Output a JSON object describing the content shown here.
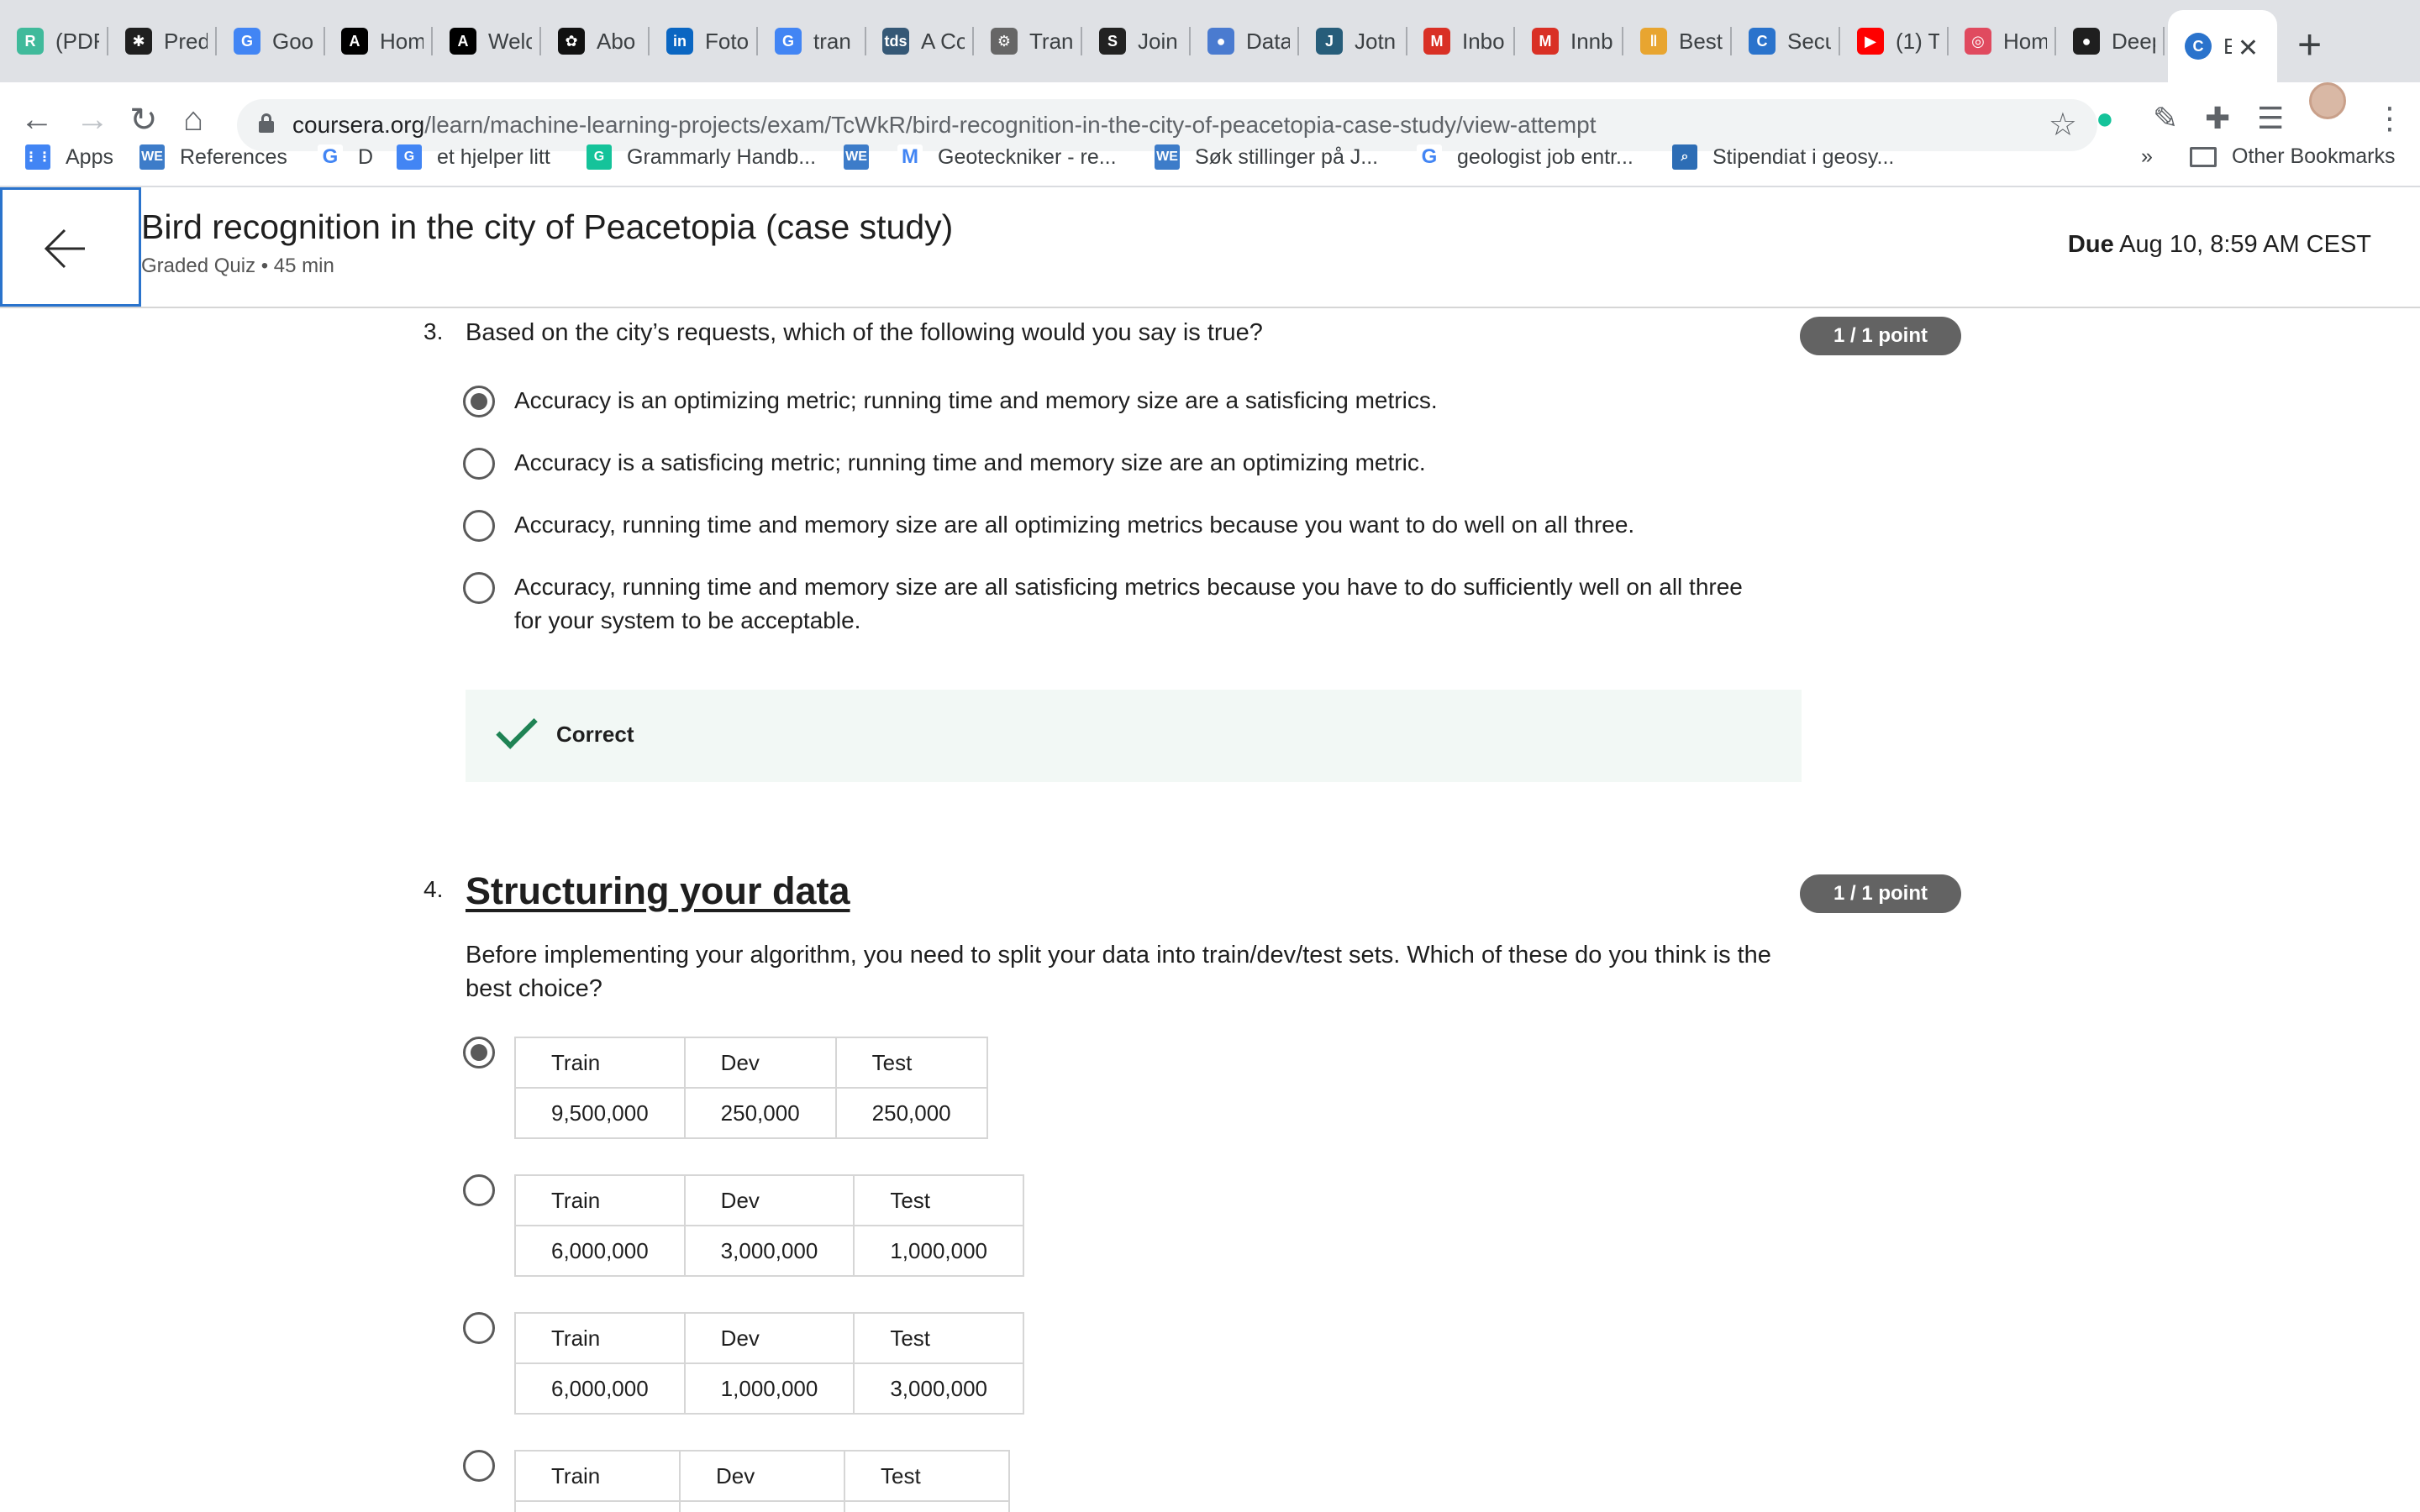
{
  "browser": {
    "tabs": [
      {
        "title": "(PDF",
        "icon": "researchgate-icon",
        "color": "#40ba9b",
        "glyph": "R"
      },
      {
        "title": "Pred",
        "icon": "gear-logo-icon",
        "color": "#1f1f1f",
        "glyph": "✱"
      },
      {
        "title": "Goo",
        "icon": "google-translate-icon",
        "color": "#4285f4",
        "glyph": "G"
      },
      {
        "title": "Hom",
        "icon": "letter-a-icon",
        "color": "#000000",
        "glyph": "A"
      },
      {
        "title": "Welc",
        "icon": "letter-a-icon",
        "color": "#000000",
        "glyph": "A"
      },
      {
        "title": "Abo",
        "icon": "openai-icon",
        "color": "#111111",
        "glyph": "✿"
      },
      {
        "title": "Foto",
        "icon": "linkedin-icon",
        "color": "#0a66c2",
        "glyph": "in"
      },
      {
        "title": "tran",
        "icon": "google-icon",
        "color": "#4285f4",
        "glyph": "G"
      },
      {
        "title": "A Co",
        "icon": "tds-icon",
        "color": "#355876",
        "glyph": "tds"
      },
      {
        "title": "Tran",
        "icon": "bike-icon",
        "color": "#666666",
        "glyph": "⚙"
      },
      {
        "title": "Join",
        "icon": "slack-s-icon",
        "color": "#222222",
        "glyph": "S"
      },
      {
        "title": "Data",
        "icon": "drop-icon",
        "color": "#4a7bd0",
        "glyph": "●"
      },
      {
        "title": "Jotn",
        "icon": "letter-j-icon",
        "color": "#275d7a",
        "glyph": "J"
      },
      {
        "title": "Inbo",
        "icon": "gmail-icon",
        "color": "#d93025",
        "glyph": "M"
      },
      {
        "title": "Innb",
        "icon": "gmail-icon",
        "color": "#d93025",
        "glyph": "M"
      },
      {
        "title": "Best",
        "icon": "bars-icon",
        "color": "#e8a530",
        "glyph": "‖"
      },
      {
        "title": "Secu",
        "icon": "coursera-icon",
        "color": "#2a73cc",
        "glyph": "C"
      },
      {
        "title": "(1) T",
        "icon": "youtube-icon",
        "color": "#ff0000",
        "glyph": "▶"
      },
      {
        "title": "Hom",
        "icon": "target-icon",
        "color": "#e04a5f",
        "glyph": "◎"
      },
      {
        "title": "Deep",
        "icon": "github-icon",
        "color": "#1f1f1f",
        "glyph": "●"
      }
    ],
    "active_tab": {
      "title": "E",
      "icon": "coursera-icon",
      "color": "#2a73cc",
      "glyph": "C"
    },
    "url_host": "coursera.org",
    "url_path": "/learn/machine-learning-projects/exam/TcWkR/bird-recognition-in-the-city-of-peacetopia-case-study/view-attempt",
    "bookmarks": [
      {
        "label": "Apps",
        "icon": "apps-grid-icon",
        "color": "#4285f4",
        "glyph": "⋮⋮"
      },
      {
        "label": "References",
        "icon": "we-icon",
        "color": "#3d7cc9",
        "glyph": "WE"
      },
      {
        "label": "D",
        "icon": "google-icon",
        "color": "#ffffff",
        "glyph": "G"
      },
      {
        "label": "et hjelper litt",
        "icon": "google-translate-icon",
        "color": "#4285f4",
        "glyph": "G"
      },
      {
        "label": "Grammarly Handb...",
        "icon": "grammarly-icon",
        "color": "#15c39a",
        "glyph": "G"
      },
      {
        "label": "",
        "icon": "we-icon",
        "color": "#3d7cc9",
        "glyph": "WE"
      },
      {
        "label": "Geoteckniker - re...",
        "icon": "gmail-icon",
        "color": "#ffffff",
        "glyph": "M"
      },
      {
        "label": "Søk stillinger på J...",
        "icon": "we-icon",
        "color": "#3d7cc9",
        "glyph": "WE"
      },
      {
        "label": "geologist job entr...",
        "icon": "google-icon",
        "color": "#ffffff",
        "glyph": "G"
      },
      {
        "label": "Stipendiat i geosy...",
        "icon": "search-site-icon",
        "color": "#2d6db5",
        "glyph": "⌕"
      }
    ],
    "overflow_label": "»",
    "other_bookmarks": "Other Bookmarks"
  },
  "header": {
    "title": "Bird recognition in the city of Peacetopia (case study)",
    "subtitle": "Graded Quiz • 45 min",
    "due_label": "Due",
    "due_date": "Aug 10, 8:59 AM CEST"
  },
  "questions": [
    {
      "number": "3.",
      "text": "Based on the city’s requests, which of the following would you say is true?",
      "points": "1 / 1 point",
      "options": [
        {
          "text": "Accuracy is an optimizing metric; running time and memory size are a satisficing metrics.",
          "selected": true
        },
        {
          "text": "Accuracy is a satisficing metric; running time and memory size are an optimizing metric.",
          "selected": false
        },
        {
          "text": "Accuracy, running time and memory size are all optimizing metrics because you want to do well on all three.",
          "selected": false
        },
        {
          "text": "Accuracy, running time and memory size are all satisficing metrics because you have to do sufficiently well on all three for your system to be acceptable.",
          "selected": false
        }
      ],
      "feedback": "Correct"
    },
    {
      "number": "4.",
      "title": "Structuring your data",
      "text": "Before implementing your algorithm, you need to split your data into train/dev/test sets. Which of these do you think is the best choice?",
      "points": "1 / 1 point",
      "headers": [
        "Train",
        "Dev",
        "Test"
      ],
      "options": [
        {
          "values": [
            "9,500,000",
            "250,000",
            "250,000"
          ],
          "selected": true
        },
        {
          "values": [
            "6,000,000",
            "3,000,000",
            "1,000,000"
          ],
          "selected": false
        },
        {
          "values": [
            "6,000,000",
            "1,000,000",
            "3,000,000"
          ],
          "selected": false
        },
        {
          "values": [
            "",
            "",
            ""
          ],
          "selected": false
        }
      ]
    }
  ]
}
